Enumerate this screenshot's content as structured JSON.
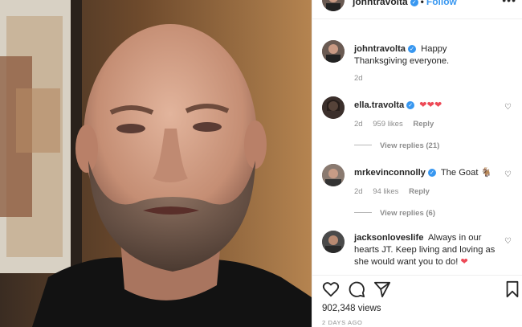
{
  "post": {
    "author": "johntravolta",
    "follow_label": "Follow",
    "dot": "•",
    "more_icon": "•••",
    "caption": {
      "username": "johntravolta",
      "text": "Happy Thanksgiving everyone.",
      "age": "2d"
    }
  },
  "comments": [
    {
      "username": "ella.travolta",
      "verified": true,
      "text": "",
      "hearts": "❤❤❤",
      "age": "2d",
      "likes": "959 likes",
      "reply_label": "Reply",
      "view_replies": "View replies (21)"
    },
    {
      "username": "mrkevinconnolly",
      "verified": true,
      "text": "The Goat 🐐",
      "age": "2d",
      "likes": "94 likes",
      "reply_label": "Reply",
      "view_replies": "View replies (6)"
    },
    {
      "username": "jacksonloveslife",
      "verified": false,
      "text": "Always in our hearts JT. Keep living and loving as she would want you to do!",
      "hearts": "❤"
    }
  ],
  "actions": {
    "like_icon": "heart-icon",
    "comment_icon": "comment-icon",
    "share_icon": "share-icon",
    "save_icon": "bookmark-icon"
  },
  "views": "902,348 views",
  "time_ago": "2 DAYS AGO",
  "colors": {
    "link_blue": "#3897f0",
    "meta_grey": "#8e8e8e",
    "heart_red": "#ed4956"
  }
}
